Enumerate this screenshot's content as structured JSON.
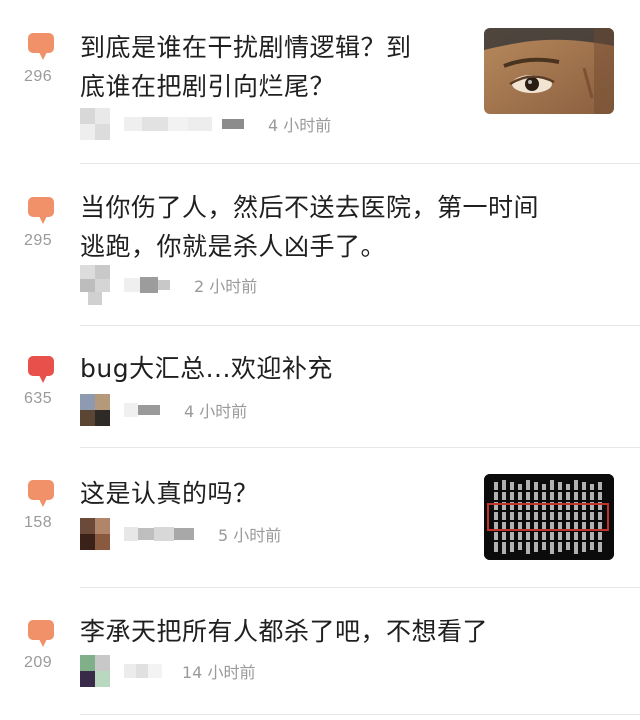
{
  "posts": [
    {
      "title_line1": "到底是谁在干扰剧情逻辑？到",
      "title_line2": "底谁在把剧引向烂尾？",
      "reply_count": "296",
      "time": "4 小时前",
      "bubble_color": "#f0916a",
      "has_thumbnail": true,
      "thumbnail": "face-closeup-icon"
    },
    {
      "title_line1": "当你伤了人，然后不送去医院，第一时间",
      "title_line2": "逃跑，你就是杀人凶手了。",
      "reply_count": "295",
      "time": "2 小时前",
      "bubble_color": "#f0916a",
      "has_thumbnail": false
    },
    {
      "title_line1": "bug大汇总...欢迎补充",
      "reply_count": "635",
      "time": "4 小时前",
      "bubble_color": "#e8514b",
      "has_thumbnail": false
    },
    {
      "title_line1": "这是认真的吗？",
      "reply_count": "158",
      "time": "5 小时前",
      "bubble_color": "#f0916a",
      "has_thumbnail": true,
      "thumbnail": "text-document-icon"
    },
    {
      "title_line1": "李承天把所有人都杀了吧，不想看了",
      "reply_count": "209",
      "time": "14 小时前",
      "bubble_color": "#f0916a",
      "has_thumbnail": false
    }
  ]
}
